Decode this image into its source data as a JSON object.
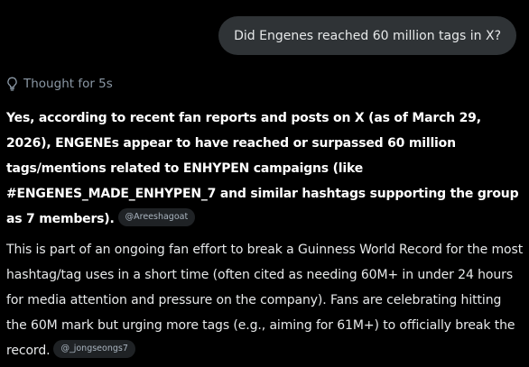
{
  "user_message": "Did Engenes reached 60 million tags in X?",
  "thought": {
    "icon": "lightbulb-icon",
    "label": "Thought for 5s"
  },
  "answer": {
    "paragraph_1": "Yes, according to recent fan reports and posts on X (as of March 29, 2026), ENGENEs appear to have reached or surpassed 60 million tags/mentions related to ENHYPEN campaigns (like #ENGENES_MADE_ENHYPEN_7 and similar hashtags supporting the group as 7 members).",
    "citation_1": "@Areeshagoat",
    "paragraph_2": "This is part of an ongoing fan effort to break a Guinness World Record for the most hashtag/tag uses in a short time (often cited as needing 60M+ in under 24 hours for media attention and pressure on the company). Fans are celebrating hitting the 60M mark but urging more tags (e.g., aiming for 61M+) to officially break the record.",
    "citation_2": "@_jongseongs7"
  },
  "colors": {
    "background": "#000000",
    "bubble": "#2f3336",
    "text": "#e7e9ea",
    "muted": "#8b98a5",
    "chip_bg": "#1f2225"
  }
}
